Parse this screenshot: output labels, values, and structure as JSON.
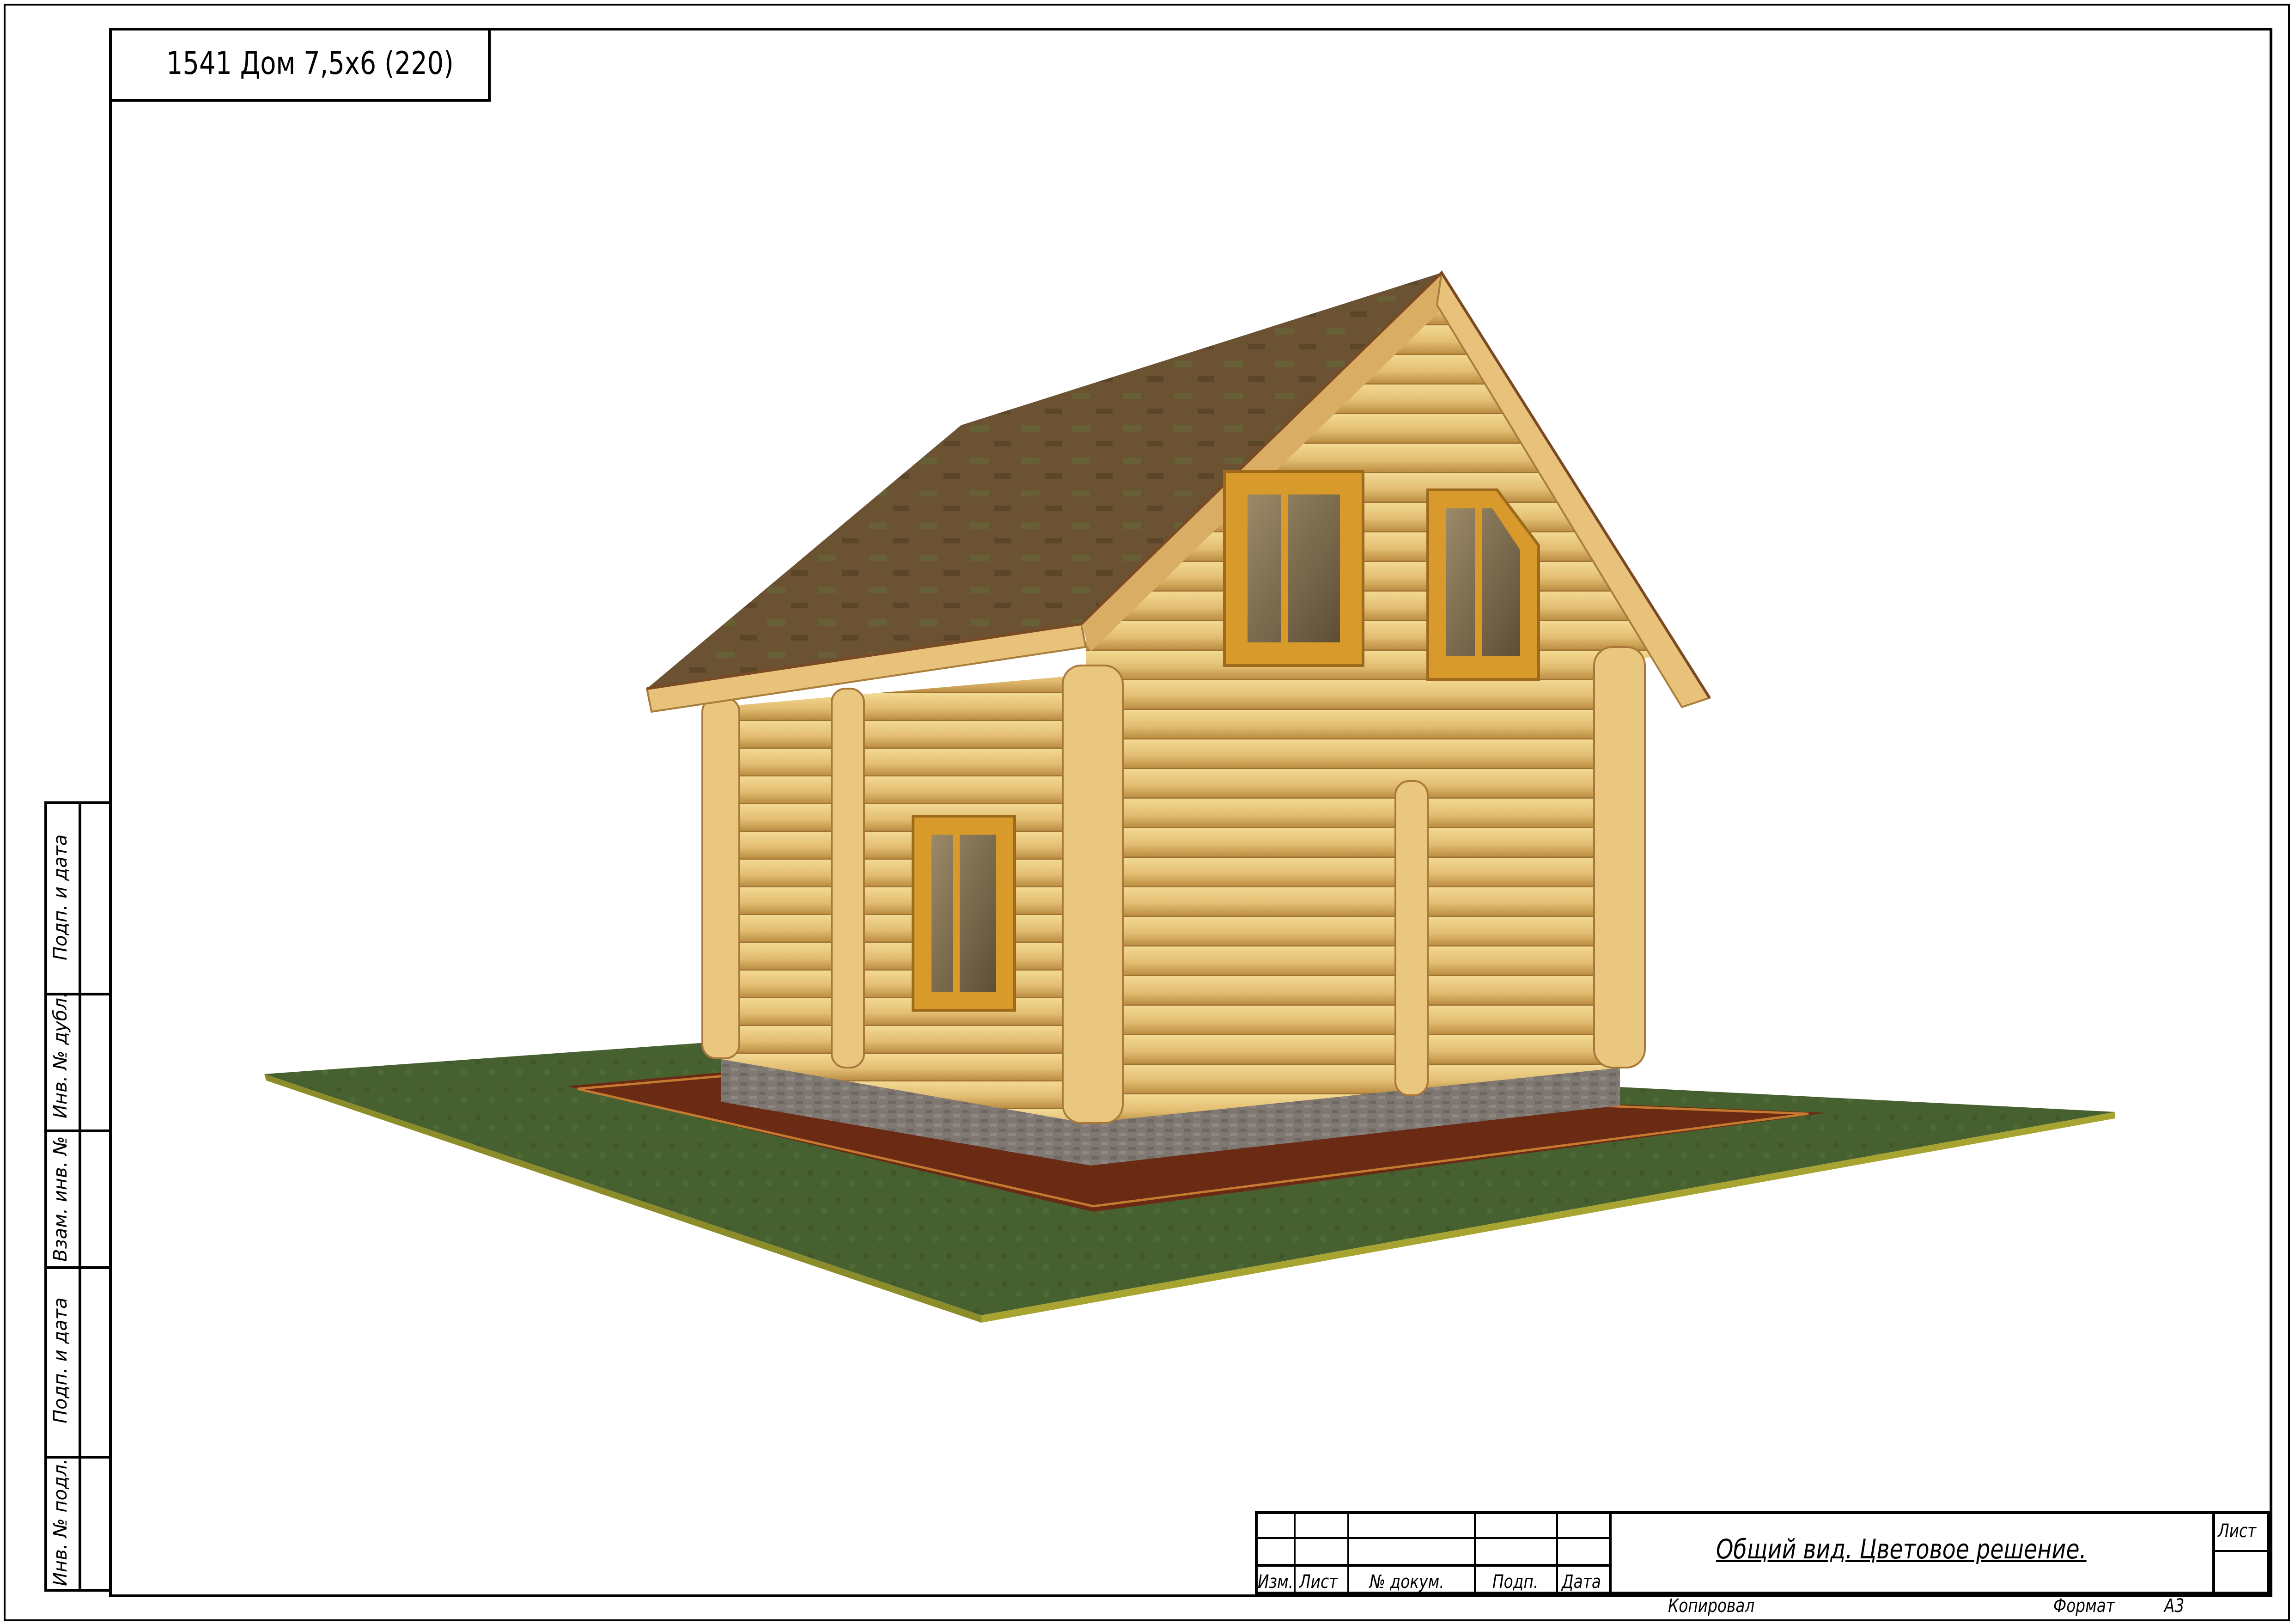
{
  "drawing_title": "1541 Дом 7,5х6 (220)",
  "side_stamp": {
    "fields": [
      "Подп. и дата",
      "Инв. № дубл.",
      "Взам. инв. №",
      "Подп. и дата",
      "Инв. № подл."
    ]
  },
  "title_block": {
    "columns": [
      "Изм.",
      "Лист",
      "№ докум.",
      "Подп.",
      "Дата"
    ],
    "sheet_name": "Общий вид. Цветовое решение.",
    "sheet_label": "Лист"
  },
  "footer": {
    "copied_label": "Копировал",
    "format_label": "Формат",
    "format_value": "А3"
  },
  "image": {
    "subject": "log-house-3d-render",
    "colors": {
      "roof": "#6b4f2f",
      "logs": "#e6c27a",
      "log_shadow": "#b98a3e",
      "window_frame": "#d89a2a",
      "glass": "#7b6a50",
      "plinth": "#7f7872",
      "ground": "#46602f",
      "soil": "#6a2a14"
    }
  }
}
